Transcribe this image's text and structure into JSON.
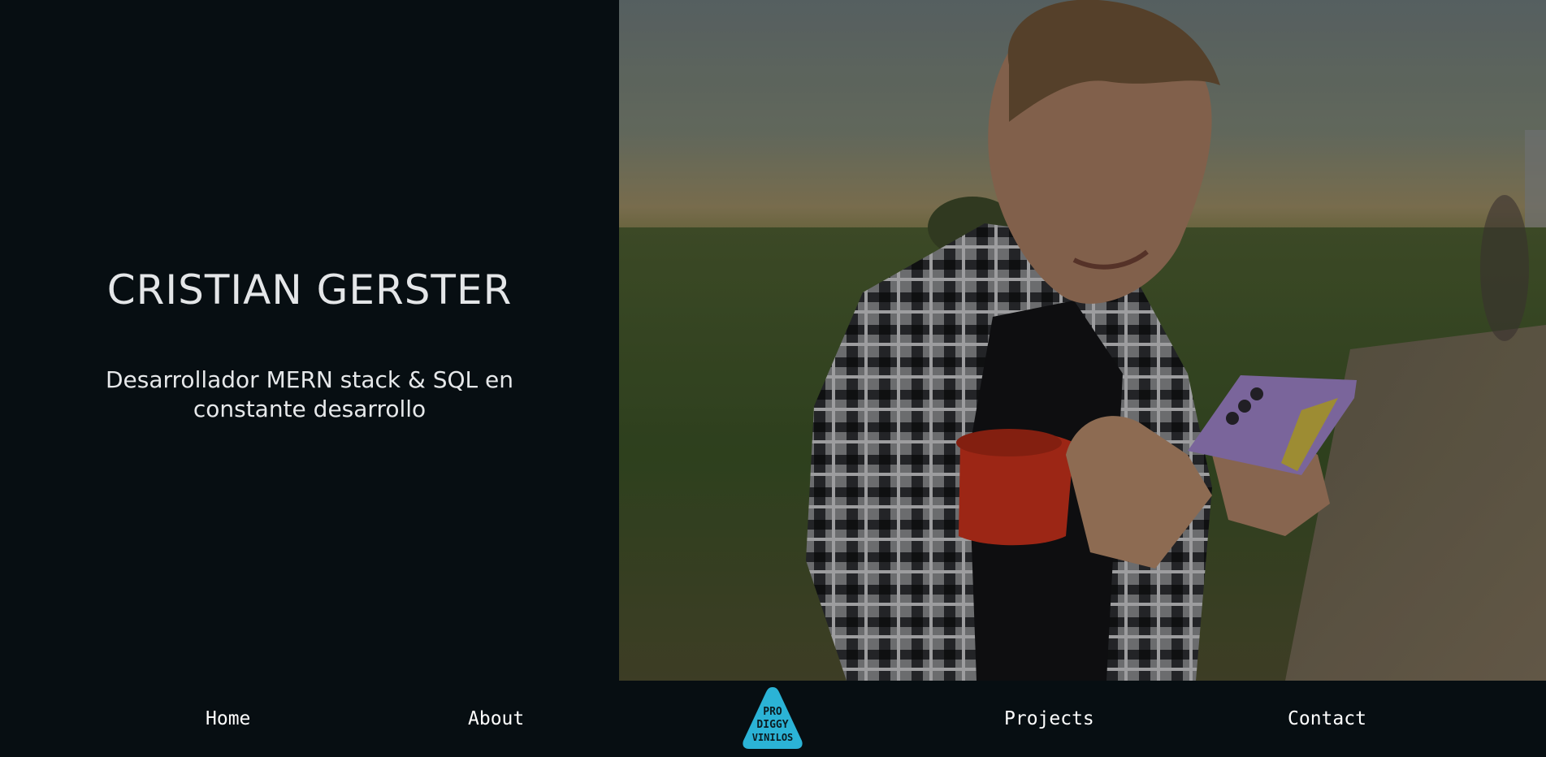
{
  "hero": {
    "name": "CRISTIAN GERSTER",
    "subtitle": "Desarrollador MERN stack & SQL en constante desarrollo"
  },
  "nav": {
    "items": [
      {
        "label": "Home"
      },
      {
        "label": "About"
      },
      {
        "label": "Projects"
      },
      {
        "label": "Contact"
      }
    ],
    "logo": {
      "line1": "PRO",
      "line2": "DIGGY",
      "line3": "VINILOS",
      "color": "#2bb3d6"
    }
  },
  "colors": {
    "background": "#070e12",
    "text": "#e4e6e8",
    "accent": "#2bb3d6"
  },
  "photo": {
    "subject": "portrait-photo"
  }
}
